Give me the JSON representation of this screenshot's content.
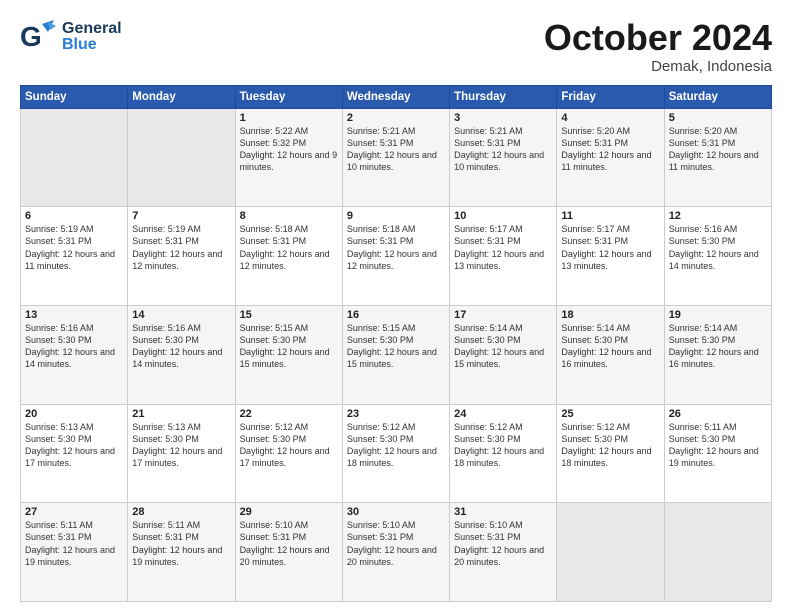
{
  "header": {
    "logo_general": "General",
    "logo_blue": "Blue",
    "month": "October 2024",
    "location": "Demak, Indonesia"
  },
  "weekdays": [
    "Sunday",
    "Monday",
    "Tuesday",
    "Wednesday",
    "Thursday",
    "Friday",
    "Saturday"
  ],
  "weeks": [
    [
      {
        "day": "",
        "sunrise": "",
        "sunset": "",
        "daylight": "",
        "empty": true
      },
      {
        "day": "",
        "sunrise": "",
        "sunset": "",
        "daylight": "",
        "empty": true
      },
      {
        "day": "1",
        "sunrise": "Sunrise: 5:22 AM",
        "sunset": "Sunset: 5:32 PM",
        "daylight": "Daylight: 12 hours and 9 minutes."
      },
      {
        "day": "2",
        "sunrise": "Sunrise: 5:21 AM",
        "sunset": "Sunset: 5:31 PM",
        "daylight": "Daylight: 12 hours and 10 minutes."
      },
      {
        "day": "3",
        "sunrise": "Sunrise: 5:21 AM",
        "sunset": "Sunset: 5:31 PM",
        "daylight": "Daylight: 12 hours and 10 minutes."
      },
      {
        "day": "4",
        "sunrise": "Sunrise: 5:20 AM",
        "sunset": "Sunset: 5:31 PM",
        "daylight": "Daylight: 12 hours and 11 minutes."
      },
      {
        "day": "5",
        "sunrise": "Sunrise: 5:20 AM",
        "sunset": "Sunset: 5:31 PM",
        "daylight": "Daylight: 12 hours and 11 minutes."
      }
    ],
    [
      {
        "day": "6",
        "sunrise": "Sunrise: 5:19 AM",
        "sunset": "Sunset: 5:31 PM",
        "daylight": "Daylight: 12 hours and 11 minutes."
      },
      {
        "day": "7",
        "sunrise": "Sunrise: 5:19 AM",
        "sunset": "Sunset: 5:31 PM",
        "daylight": "Daylight: 12 hours and 12 minutes."
      },
      {
        "day": "8",
        "sunrise": "Sunrise: 5:18 AM",
        "sunset": "Sunset: 5:31 PM",
        "daylight": "Daylight: 12 hours and 12 minutes."
      },
      {
        "day": "9",
        "sunrise": "Sunrise: 5:18 AM",
        "sunset": "Sunset: 5:31 PM",
        "daylight": "Daylight: 12 hours and 12 minutes."
      },
      {
        "day": "10",
        "sunrise": "Sunrise: 5:17 AM",
        "sunset": "Sunset: 5:31 PM",
        "daylight": "Daylight: 12 hours and 13 minutes."
      },
      {
        "day": "11",
        "sunrise": "Sunrise: 5:17 AM",
        "sunset": "Sunset: 5:31 PM",
        "daylight": "Daylight: 12 hours and 13 minutes."
      },
      {
        "day": "12",
        "sunrise": "Sunrise: 5:16 AM",
        "sunset": "Sunset: 5:30 PM",
        "daylight": "Daylight: 12 hours and 14 minutes."
      }
    ],
    [
      {
        "day": "13",
        "sunrise": "Sunrise: 5:16 AM",
        "sunset": "Sunset: 5:30 PM",
        "daylight": "Daylight: 12 hours and 14 minutes."
      },
      {
        "day": "14",
        "sunrise": "Sunrise: 5:16 AM",
        "sunset": "Sunset: 5:30 PM",
        "daylight": "Daylight: 12 hours and 14 minutes."
      },
      {
        "day": "15",
        "sunrise": "Sunrise: 5:15 AM",
        "sunset": "Sunset: 5:30 PM",
        "daylight": "Daylight: 12 hours and 15 minutes."
      },
      {
        "day": "16",
        "sunrise": "Sunrise: 5:15 AM",
        "sunset": "Sunset: 5:30 PM",
        "daylight": "Daylight: 12 hours and 15 minutes."
      },
      {
        "day": "17",
        "sunrise": "Sunrise: 5:14 AM",
        "sunset": "Sunset: 5:30 PM",
        "daylight": "Daylight: 12 hours and 15 minutes."
      },
      {
        "day": "18",
        "sunrise": "Sunrise: 5:14 AM",
        "sunset": "Sunset: 5:30 PM",
        "daylight": "Daylight: 12 hours and 16 minutes."
      },
      {
        "day": "19",
        "sunrise": "Sunrise: 5:14 AM",
        "sunset": "Sunset: 5:30 PM",
        "daylight": "Daylight: 12 hours and 16 minutes."
      }
    ],
    [
      {
        "day": "20",
        "sunrise": "Sunrise: 5:13 AM",
        "sunset": "Sunset: 5:30 PM",
        "daylight": "Daylight: 12 hours and 17 minutes."
      },
      {
        "day": "21",
        "sunrise": "Sunrise: 5:13 AM",
        "sunset": "Sunset: 5:30 PM",
        "daylight": "Daylight: 12 hours and 17 minutes."
      },
      {
        "day": "22",
        "sunrise": "Sunrise: 5:12 AM",
        "sunset": "Sunset: 5:30 PM",
        "daylight": "Daylight: 12 hours and 17 minutes."
      },
      {
        "day": "23",
        "sunrise": "Sunrise: 5:12 AM",
        "sunset": "Sunset: 5:30 PM",
        "daylight": "Daylight: 12 hours and 18 minutes."
      },
      {
        "day": "24",
        "sunrise": "Sunrise: 5:12 AM",
        "sunset": "Sunset: 5:30 PM",
        "daylight": "Daylight: 12 hours and 18 minutes."
      },
      {
        "day": "25",
        "sunrise": "Sunrise: 5:12 AM",
        "sunset": "Sunset: 5:30 PM",
        "daylight": "Daylight: 12 hours and 18 minutes."
      },
      {
        "day": "26",
        "sunrise": "Sunrise: 5:11 AM",
        "sunset": "Sunset: 5:30 PM",
        "daylight": "Daylight: 12 hours and 19 minutes."
      }
    ],
    [
      {
        "day": "27",
        "sunrise": "Sunrise: 5:11 AM",
        "sunset": "Sunset: 5:31 PM",
        "daylight": "Daylight: 12 hours and 19 minutes."
      },
      {
        "day": "28",
        "sunrise": "Sunrise: 5:11 AM",
        "sunset": "Sunset: 5:31 PM",
        "daylight": "Daylight: 12 hours and 19 minutes."
      },
      {
        "day": "29",
        "sunrise": "Sunrise: 5:10 AM",
        "sunset": "Sunset: 5:31 PM",
        "daylight": "Daylight: 12 hours and 20 minutes."
      },
      {
        "day": "30",
        "sunrise": "Sunrise: 5:10 AM",
        "sunset": "Sunset: 5:31 PM",
        "daylight": "Daylight: 12 hours and 20 minutes."
      },
      {
        "day": "31",
        "sunrise": "Sunrise: 5:10 AM",
        "sunset": "Sunset: 5:31 PM",
        "daylight": "Daylight: 12 hours and 20 minutes."
      },
      {
        "day": "",
        "sunrise": "",
        "sunset": "",
        "daylight": "",
        "empty": true
      },
      {
        "day": "",
        "sunrise": "",
        "sunset": "",
        "daylight": "",
        "empty": true
      }
    ]
  ]
}
